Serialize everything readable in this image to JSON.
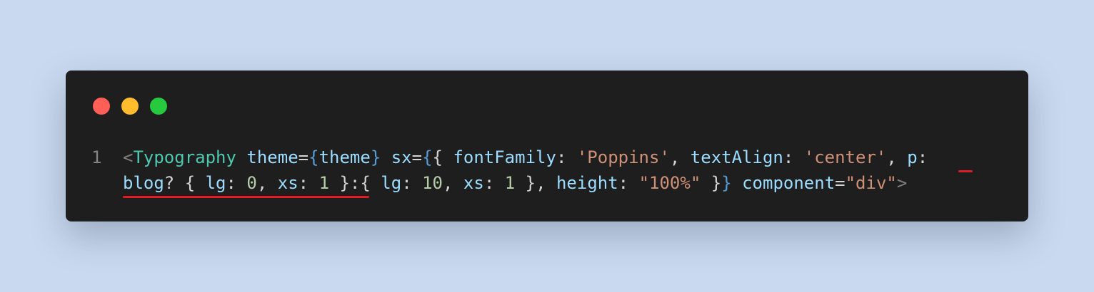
{
  "window": {
    "buttons": {
      "close_color": "#ff5f56",
      "minimize_color": "#ffbd2e",
      "maximize_color": "#27c93f"
    }
  },
  "code": {
    "line_number": "1",
    "line1": [
      {
        "text": "<",
        "type": "tag-bracket"
      },
      {
        "text": "Typography",
        "type": "tag"
      },
      {
        "text": " ",
        "type": "punct"
      },
      {
        "text": "theme",
        "type": "attr"
      },
      {
        "text": "=",
        "type": "punct"
      },
      {
        "text": "{",
        "type": "brace"
      },
      {
        "text": "theme",
        "type": "var"
      },
      {
        "text": "}",
        "type": "brace"
      },
      {
        "text": " ",
        "type": "punct"
      },
      {
        "text": "sx",
        "type": "attr"
      },
      {
        "text": "=",
        "type": "punct"
      },
      {
        "text": "{",
        "type": "brace"
      },
      {
        "text": "{ ",
        "type": "punct"
      },
      {
        "text": "fontFamily",
        "type": "var"
      },
      {
        "text": ": ",
        "type": "punct"
      },
      {
        "text": "'Poppins'",
        "type": "string"
      },
      {
        "text": ", ",
        "type": "punct"
      },
      {
        "text": "textAlign",
        "type": "var"
      },
      {
        "text": ": ",
        "type": "punct"
      },
      {
        "text": "'center'",
        "type": "string"
      },
      {
        "text": ", ",
        "type": "punct"
      },
      {
        "text": "p",
        "type": "var"
      },
      {
        "text": ":",
        "type": "punct"
      }
    ],
    "line2": [
      {
        "text": "blog",
        "type": "var"
      },
      {
        "text": "? { ",
        "type": "punct"
      },
      {
        "text": "lg",
        "type": "var"
      },
      {
        "text": ": ",
        "type": "punct"
      },
      {
        "text": "0",
        "type": "number"
      },
      {
        "text": ", ",
        "type": "punct"
      },
      {
        "text": "xs",
        "type": "var"
      },
      {
        "text": ": ",
        "type": "punct"
      },
      {
        "text": "1",
        "type": "number"
      },
      {
        "text": " }:{ ",
        "type": "punct"
      },
      {
        "text": "lg",
        "type": "var"
      },
      {
        "text": ": ",
        "type": "punct"
      },
      {
        "text": "10",
        "type": "number"
      },
      {
        "text": ", ",
        "type": "punct"
      },
      {
        "text": "xs",
        "type": "var"
      },
      {
        "text": ": ",
        "type": "punct"
      },
      {
        "text": "1",
        "type": "number"
      },
      {
        "text": " }, ",
        "type": "punct"
      },
      {
        "text": "height",
        "type": "var"
      },
      {
        "text": ": ",
        "type": "punct"
      },
      {
        "text": "\"100%\"",
        "type": "string"
      },
      {
        "text": " }",
        "type": "punct"
      },
      {
        "text": "}",
        "type": "brace"
      },
      {
        "text": " ",
        "type": "punct"
      },
      {
        "text": "component",
        "type": "attr"
      },
      {
        "text": "=",
        "type": "punct"
      },
      {
        "text": "\"div\"",
        "type": "string"
      },
      {
        "text": ">",
        "type": "tag-bracket"
      }
    ]
  },
  "annotations": {
    "underline_color": "#e01b24"
  }
}
